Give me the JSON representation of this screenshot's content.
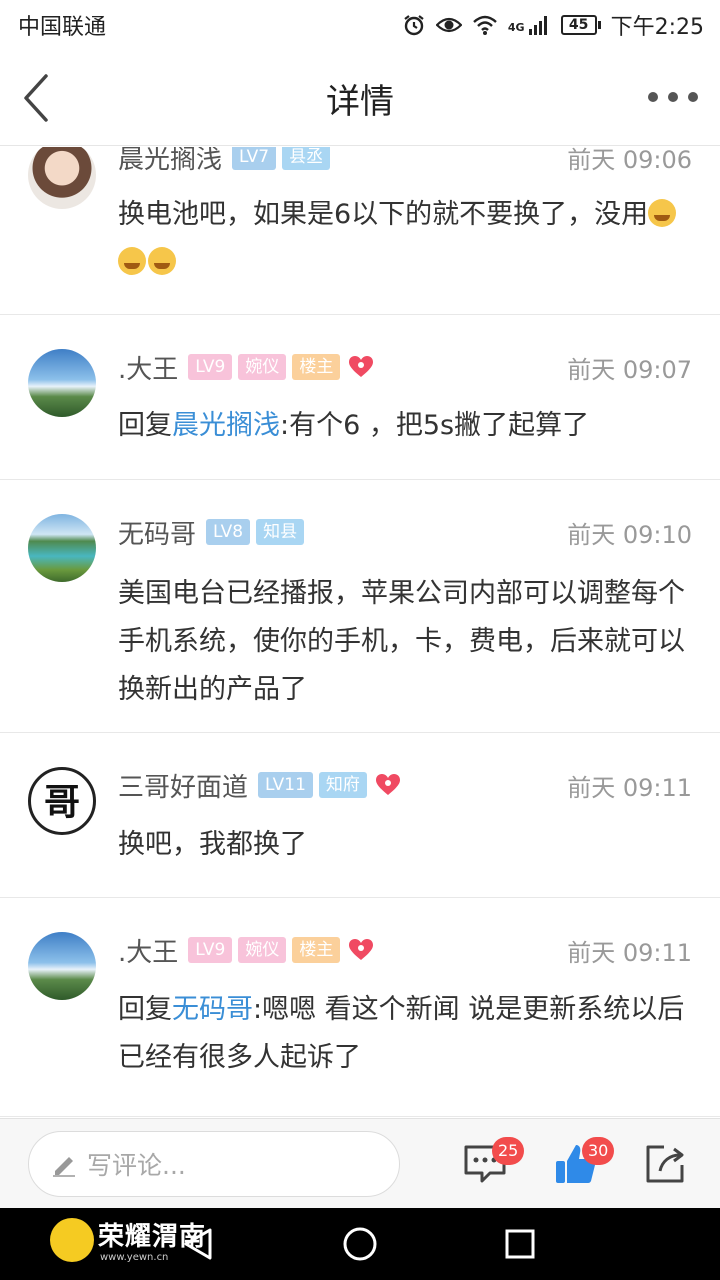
{
  "status_bar": {
    "carrier": "中国联通",
    "battery": "45",
    "time": "下午2:25",
    "network": "4G"
  },
  "nav": {
    "title": "详情"
  },
  "comments": [
    {
      "username": "晨光搁浅",
      "badges": [
        "LV7",
        "县丞"
      ],
      "time": "前天 09:06",
      "text": "换电池吧，如果是6以下的就不要换了，没用"
    },
    {
      "username": ".大王",
      "badges": [
        "LV9",
        "婉仪",
        "楼主"
      ],
      "time": "前天 09:07",
      "reply_prefix": "回复",
      "mention": "晨光搁浅",
      "text": ":有个6 ，把5s撇了起算了"
    },
    {
      "username": "无码哥",
      "badges": [
        "LV8",
        "知县"
      ],
      "time": "前天 09:10",
      "text": "美国电台已经播报，苹果公司内部可以调整每个手机系统，使你的手机，卡，费电，后来就可以换新出的产品了"
    },
    {
      "username": "三哥好面道",
      "badges": [
        "LV11",
        "知府"
      ],
      "time": "前天 09:11",
      "text": "换吧，我都换了"
    },
    {
      "username": ".大王",
      "badges": [
        "LV9",
        "婉仪",
        "楼主"
      ],
      "time": "前天 09:11",
      "reply_prefix": "回复",
      "mention": "无码哥",
      "text": ":嗯嗯 看这个新闻  说是更新系统以后  已经有很多人起诉了"
    }
  ],
  "bottom_bar": {
    "placeholder": "写评论...",
    "comment_count": "25",
    "like_count": "30"
  },
  "watermark": {
    "name": "荣耀渭南",
    "url": "www.yewn.cn"
  },
  "colors": {
    "mention": "#3a8ed6",
    "badge_count": "#f24c4c",
    "like": "#2f8ae8"
  },
  "icons": [
    "back-icon",
    "more-icon",
    "alarm-icon",
    "eye-icon",
    "wifi-icon",
    "signal-icon",
    "battery-icon",
    "heart-icon",
    "pencil-icon",
    "comment-icon",
    "like-icon",
    "share-icon",
    "back-nav-icon",
    "home-nav-icon",
    "recents-nav-icon"
  ]
}
